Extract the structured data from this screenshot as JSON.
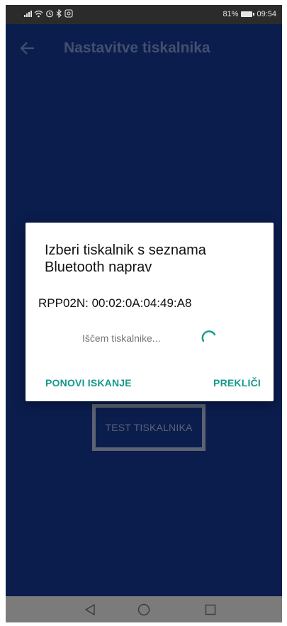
{
  "status_bar": {
    "battery_percent": "81%",
    "time": "09:54"
  },
  "app_bar": {
    "title": "Nastavitve tiskalnika",
    "back_icon": "arrow-left-icon"
  },
  "main": {
    "test_button_label": "TEST TISKALNIKA"
  },
  "dialog": {
    "title": "Izberi tiskalnik s seznama Bluetooth naprav",
    "device_entry": "RPP02N: 00:02:0A:04:49:A8",
    "searching_text": "Iščem tiskalnike...",
    "retry_label": "PONOVI ISKANJE",
    "cancel_label": "PREKLIČI",
    "accent_color": "#14998a"
  },
  "nav_bar": {
    "back_icon": "triangle-back-icon",
    "home_icon": "circle-home-icon",
    "recent_icon": "square-recent-icon"
  }
}
